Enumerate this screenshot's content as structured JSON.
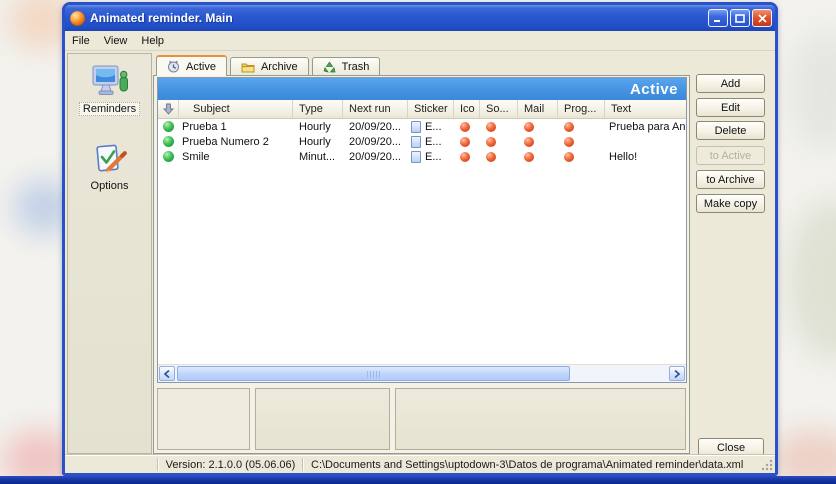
{
  "window": {
    "title": "Animated reminder. Main"
  },
  "menu": {
    "items": [
      "File",
      "View",
      "Help"
    ]
  },
  "sidebar": {
    "items": [
      "Reminders",
      "Options"
    ]
  },
  "tabs": {
    "active": "Active",
    "archive": "Archive",
    "trash": "Trash"
  },
  "banner": {
    "title": "Active"
  },
  "list": {
    "columns": {
      "subject": "Subject",
      "type": "Type",
      "next_run": "Next run",
      "sticker": "Sticker",
      "ico": "Ico",
      "so": "So...",
      "mail": "Mail",
      "prog": "Prog...",
      "text": "Text"
    },
    "rows": [
      {
        "subject": "Prueba 1",
        "type": "Hourly",
        "next_run": "20/09/20...",
        "sticker": "E...",
        "text": "Prueba para Ani..."
      },
      {
        "subject": "Prueba Numero 2",
        "type": "Hourly",
        "next_run": "20/09/20...",
        "sticker": "E...",
        "text": ""
      },
      {
        "subject": "Smile",
        "type": "Minut...",
        "next_run": "20/09/20...",
        "sticker": "E...",
        "text": "Hello!"
      }
    ]
  },
  "actions": {
    "add": "Add",
    "edit": "Edit",
    "delete": "Delete",
    "to_active": "to Active",
    "to_archive": "to Archive",
    "make_copy": "Make copy",
    "close": "Close"
  },
  "statusbar": {
    "version": "Version: 2.1.0.0 (05.06.06)",
    "path": "C:\\Documents and Settings\\uptodown-3\\Datos de programa\\Animated reminder\\data.xml"
  },
  "icons": {
    "app": "orange-sphere",
    "minimize": "white-bar",
    "maximize": "white-square",
    "close": "white-x",
    "reminders": "computer-monitor-with-figure",
    "options": "note-with-check-and-pencil",
    "tab_active": "clock",
    "tab_archive": "yellow-folder",
    "tab_trash": "recycle",
    "sort": "down-arrow",
    "status_active": "green-dot",
    "alarm": "red-dot",
    "sticker": "blue-note-page"
  },
  "colors": {
    "titlebar": "#2a57cf",
    "banner": "#4493e2",
    "client_bg": "#ece9d8",
    "tab_highlight": "#e8913c",
    "status_green": "#22a040",
    "status_red": "#e04a2a",
    "window_border": "#2b51c6"
  }
}
